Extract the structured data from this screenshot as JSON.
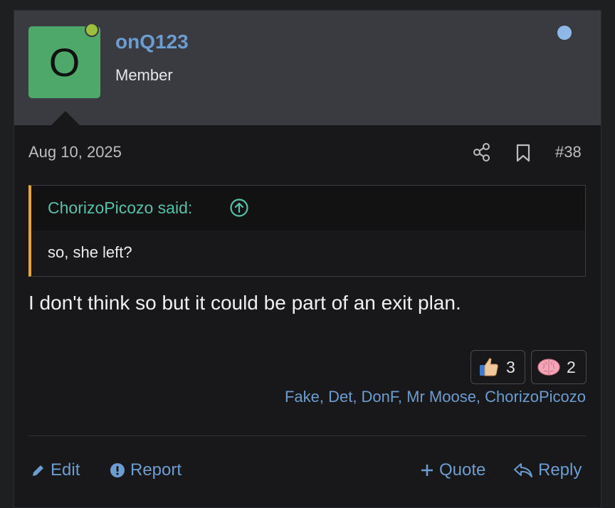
{
  "user": {
    "avatar_letter": "O",
    "username": "onQ123",
    "title": "Member"
  },
  "post": {
    "date": "Aug 10, 2025",
    "number": "#38",
    "icons": [
      "share-icon",
      "bookmark-icon"
    ],
    "quote": {
      "author_line": "ChorizoPicozo said:",
      "text": "so, she left?"
    },
    "message": "I don't think so but it could be part of an exit plan.",
    "reactions": [
      {
        "emoji": "thumbs-up-icon",
        "count": "3"
      },
      {
        "emoji": "brain-icon",
        "count": "2"
      }
    ],
    "reactors": "Fake, Det, DonF, Mr Moose, ChorizoPicozo"
  },
  "actions": {
    "edit": "Edit",
    "report": "Report",
    "quote": "Quote",
    "reply": "Reply"
  },
  "colors": {
    "link": "#6c9dd0",
    "avatar_bg": "#4ea86a",
    "online": "#9bc03d",
    "quote_accent": "#e8a33a",
    "quote_author": "#58c0a6"
  }
}
